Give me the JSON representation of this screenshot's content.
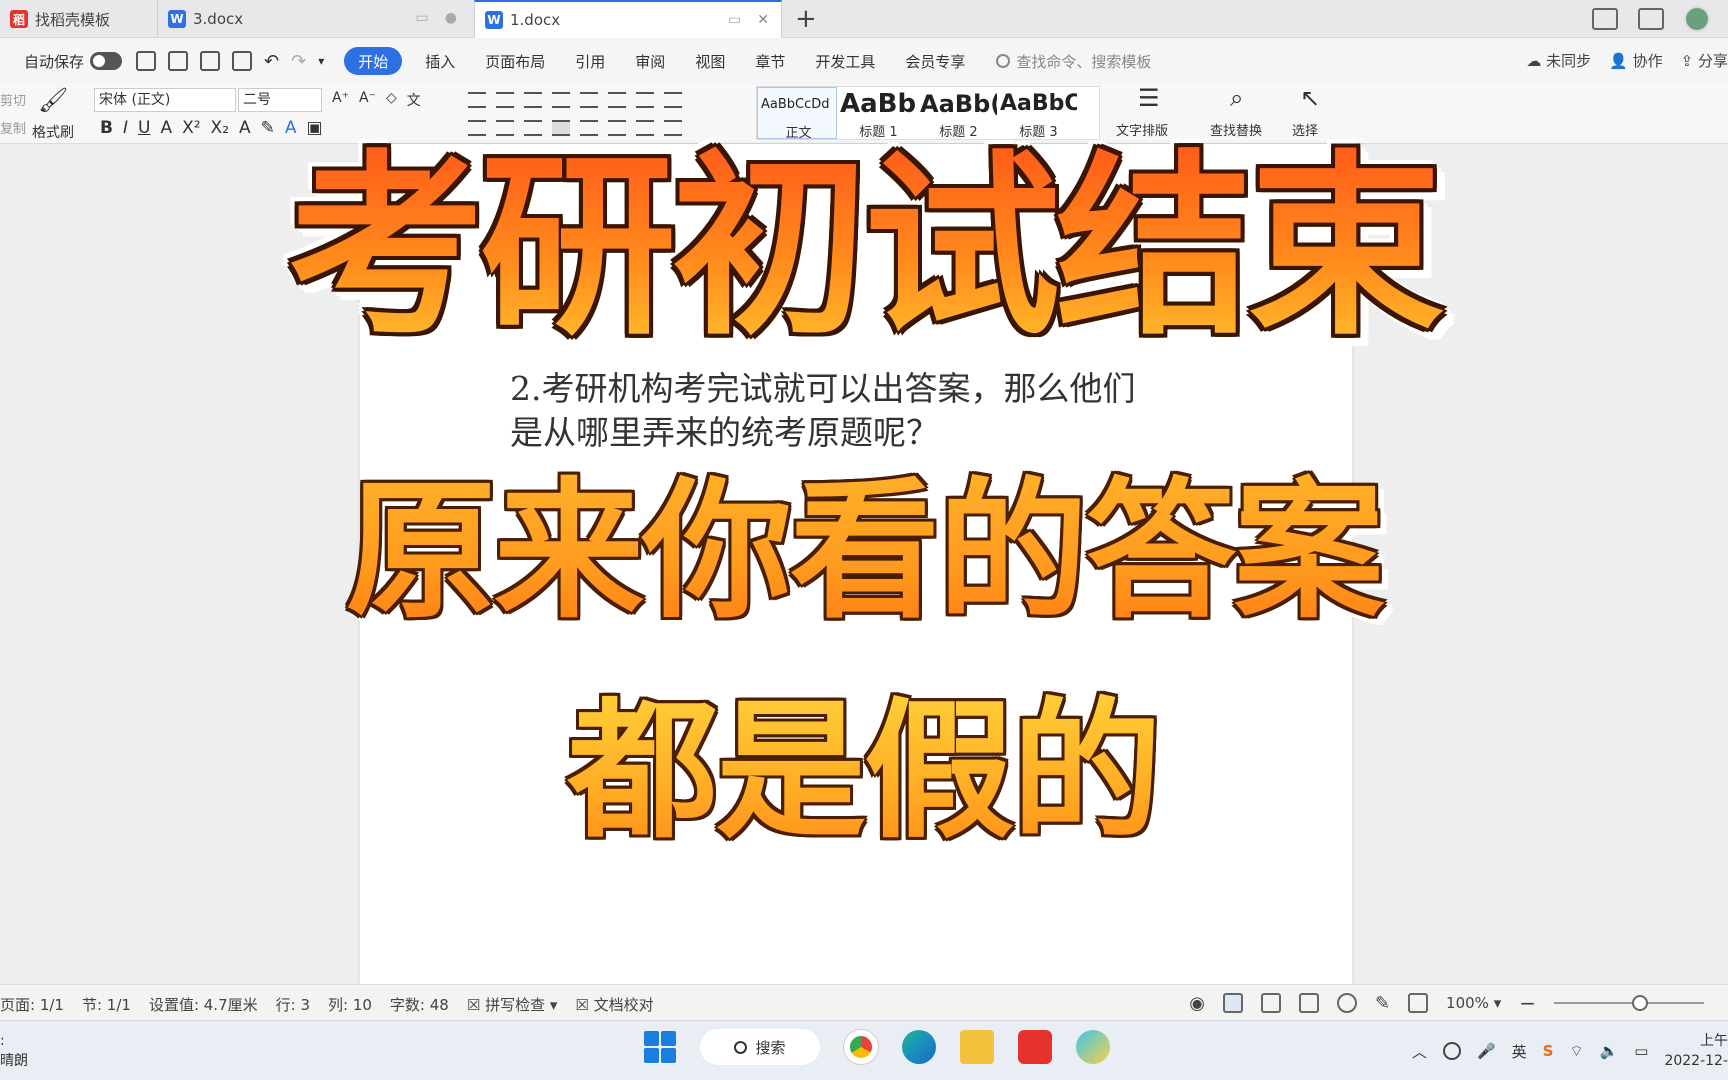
{
  "tabs": [
    {
      "label": "找稻壳模板",
      "icon": "wps-docer-icon",
      "color": "#e5322d"
    },
    {
      "label": "3.docx",
      "icon": "word-doc-icon",
      "color": "#2f6fe4"
    },
    {
      "label": "1.docx",
      "icon": "word-doc-icon",
      "color": "#2f6fe4",
      "active": true
    }
  ],
  "menubar": {
    "autosave": "自动保存",
    "items": [
      "开始",
      "插入",
      "页面布局",
      "引用",
      "审阅",
      "视图",
      "章节",
      "开发工具",
      "会员专享"
    ],
    "search_placeholder": "查找命令、搜索模板",
    "sync": "未同步",
    "collab": "协作",
    "share": "分享"
  },
  "ribbon": {
    "cut": "剪切",
    "copy": "复制",
    "format_painter": "格式刷",
    "font": "宋体 (正文)",
    "size": "二号",
    "styles": [
      {
        "preview": "AaBbCcDd",
        "name": "正文"
      },
      {
        "preview": "AaBb",
        "name": "标题 1"
      },
      {
        "preview": "AaBb(",
        "name": "标题 2"
      },
      {
        "preview": "AaBbC",
        "name": "标题 3"
      }
    ],
    "text_layout": "文字排版",
    "find_replace": "查找替换",
    "select": "选择"
  },
  "document": {
    "line1": "2.考研机构考完试就可以出答案，那么他们",
    "line2": "是从哪里弄来的统考原题呢？"
  },
  "overlay": {
    "title": "考研初试结束",
    "line2": "原来你看的答案",
    "line3": "都是假的"
  },
  "statusbar": {
    "page": "页面: 1/1",
    "section": "节: 1/1",
    "setting": "设置值: 4.7厘米",
    "row": "行: 3",
    "col": "列: 10",
    "wordcount": "字数: 48",
    "spellcheck": "拼写检查",
    "proofread": "文档校对",
    "zoom": "100%"
  },
  "taskbar": {
    "weather": "晴朗",
    "search": "搜索",
    "ime": "英",
    "time": "上午",
    "date": "2022-12-"
  },
  "colors": {
    "accent": "#2f6fe4",
    "overlay_orange": "#ff7b1a"
  }
}
